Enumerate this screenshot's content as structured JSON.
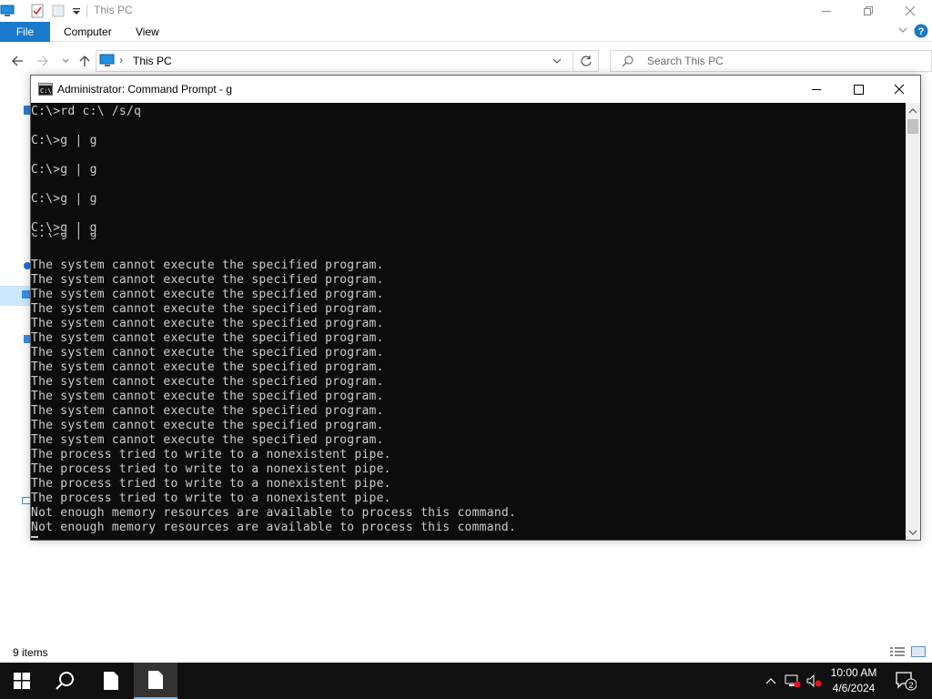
{
  "explorer": {
    "title": "This PC",
    "ribbon_tabs": [
      "File",
      "Computer",
      "View"
    ],
    "address": "This PC",
    "search_placeholder": "Search This PC",
    "status_items": "9 items"
  },
  "cmd": {
    "title": "Administrator: Command Prompt - g",
    "ghost_line": "C:\\>g | g",
    "lines": [
      "C:\\>rd c:\\ /s/q",
      "",
      "C:\\>g | g",
      "",
      "C:\\>g | g",
      "",
      "C:\\>g | g",
      "",
      "C:\\>g | g",
      "",
      "The system cannot execute the specified program.",
      "The system cannot execute the specified program.",
      "The system cannot execute the specified program.",
      "The system cannot execute the specified program.",
      "The system cannot execute the specified program.",
      "The system cannot execute the specified program.",
      "The system cannot execute the specified program.",
      "The system cannot execute the specified program.",
      "The system cannot execute the specified program.",
      "The system cannot execute the specified program.",
      "The system cannot execute the specified program.",
      "The system cannot execute the specified program.",
      "The system cannot execute the specified program.",
      "The process tried to write to a nonexistent pipe.",
      "The process tried to write to a nonexistent pipe.",
      "The process tried to write to a nonexistent pipe.",
      "The process tried to write to a nonexistent pipe.",
      "Not enough memory resources are available to process this command.",
      "Not enough memory resources are available to process this command."
    ]
  },
  "taskbar": {
    "time": "10:00 AM",
    "date": "4/6/2024",
    "notification_count": "2"
  },
  "colors": {
    "file_tab": "#1979ca",
    "console_bg": "#0c0c0c",
    "console_fg": "#cccccc",
    "taskbar_bg": "#101010",
    "active_indicator": "#76b9ed"
  }
}
